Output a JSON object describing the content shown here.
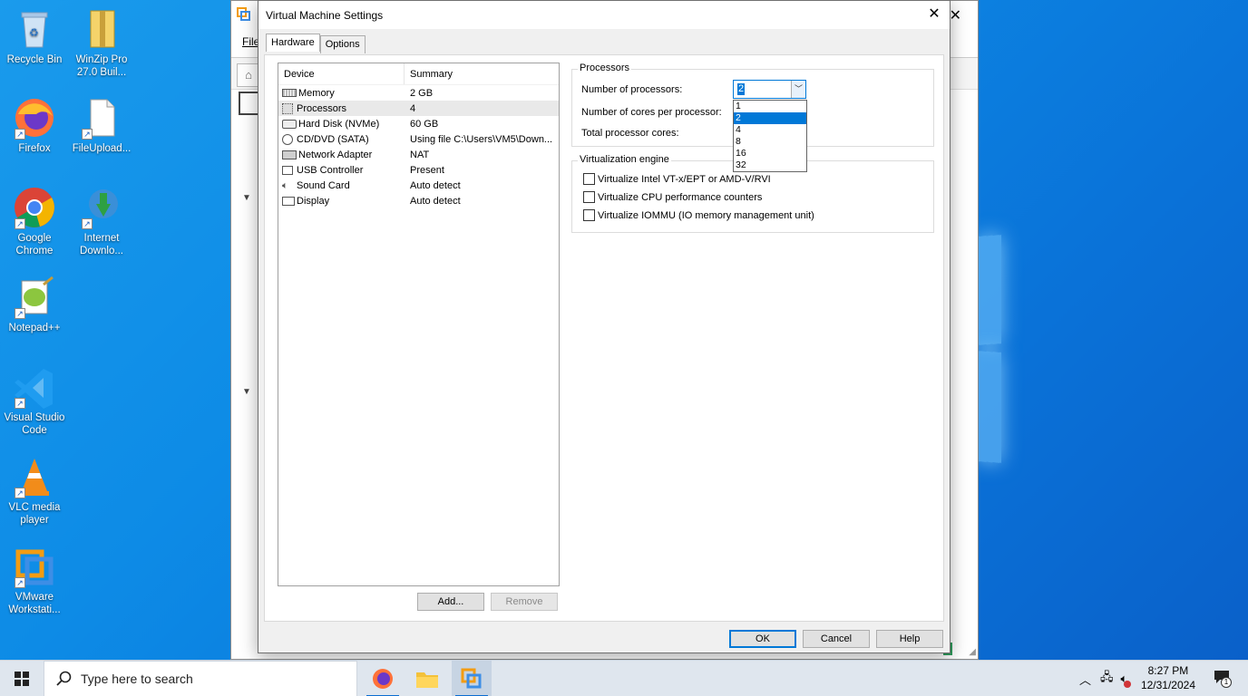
{
  "desktop": {
    "icons": [
      {
        "label": "Recycle Bin",
        "icon": "recycle-bin-icon"
      },
      {
        "label": "WinZip Pro 27.0 Buil...",
        "icon": "winzip-icon"
      },
      {
        "label": "Firefox",
        "icon": "firefox-icon"
      },
      {
        "label": "FileUpload...",
        "icon": "file-icon"
      },
      {
        "label": "Google Chrome",
        "icon": "chrome-icon"
      },
      {
        "label": "Internet Downlo...",
        "icon": "idm-icon"
      },
      {
        "label": "Notepad++",
        "icon": "notepadpp-icon"
      },
      {
        "label": "Visual Studio Code",
        "icon": "vscode-icon"
      },
      {
        "label": "VLC media player",
        "icon": "vlc-icon"
      },
      {
        "label": "VMware Workstati...",
        "icon": "vmware-icon"
      }
    ]
  },
  "background_window": {
    "menu_file": "File"
  },
  "dialog": {
    "title": "Virtual Machine Settings",
    "tabs": [
      "Hardware",
      "Options"
    ],
    "device_list": {
      "col_device": "Device",
      "col_summary": "Summary",
      "rows": [
        {
          "device": "Memory",
          "summary": "2 GB",
          "icon": "memory-icon"
        },
        {
          "device": "Processors",
          "summary": "4",
          "icon": "processor-icon"
        },
        {
          "device": "Hard Disk (NVMe)",
          "summary": "60 GB",
          "icon": "hard-disk-icon"
        },
        {
          "device": "CD/DVD (SATA)",
          "summary": "Using file C:\\Users\\VM5\\Down...",
          "icon": "cd-dvd-icon"
        },
        {
          "device": "Network Adapter",
          "summary": "NAT",
          "icon": "network-adapter-icon"
        },
        {
          "device": "USB Controller",
          "summary": "Present",
          "icon": "usb-icon"
        },
        {
          "device": "Sound Card",
          "summary": "Auto detect",
          "icon": "sound-icon"
        },
        {
          "device": "Display",
          "summary": "Auto detect",
          "icon": "display-icon"
        }
      ],
      "selected_index": 1
    },
    "add_button": "Add...",
    "remove_button": "Remove",
    "processors": {
      "group_title": "Processors",
      "num_processors_label": "Number of processors:",
      "cores_label": "Number of cores per processor:",
      "total_label": "Total processor cores:",
      "selected_value": "2",
      "options": [
        "1",
        "2",
        "4",
        "8",
        "16",
        "32"
      ]
    },
    "virtualization": {
      "group_title": "Virtualization engine",
      "options": [
        {
          "label": "Virtualize Intel VT-x/EPT or AMD-V/RVI",
          "checked": false
        },
        {
          "label": "Virtualize CPU performance counters",
          "checked": false
        },
        {
          "label": "Virtualize IOMMU (IO memory management unit)",
          "checked": false
        }
      ]
    },
    "ok_button": "OK",
    "cancel_button": "Cancel",
    "help_button": "Help"
  },
  "taskbar": {
    "search_placeholder": "Type here to search",
    "time": "8:27 PM",
    "date": "12/31/2024",
    "notification_count": "1"
  }
}
